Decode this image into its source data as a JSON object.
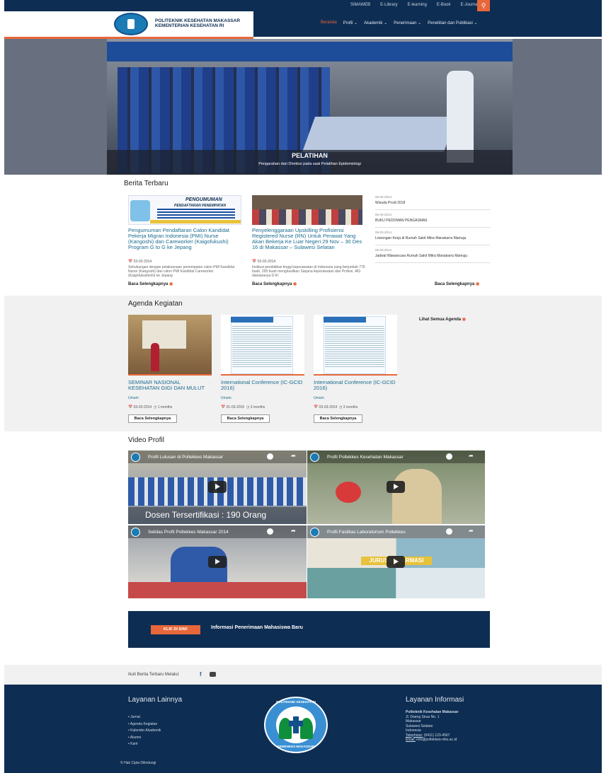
{
  "header": {
    "toplinks": [
      "SIMAWEB",
      "E-Library",
      "E-learning",
      "E-Book",
      "E-Journal"
    ],
    "search_icon": "search-icon",
    "logo_line1": "POLITEKNIK KESEHATAN MAKASSAR",
    "logo_line2": "KEMENTERIAN KESEHATAN RI",
    "nav": [
      "Beranda",
      "Profil ⌄",
      "Akademik ⌄",
      "Penerimaan ⌄",
      "Penelitian dan Publikasi ⌄"
    ],
    "accent_color": "#e8673a",
    "brand_color": "#0e2d52"
  },
  "hero": {
    "title": "PELATIHAN",
    "subtitle": "Pengarahan dari Direktur pada saat Pelatihan Epidemiologi"
  },
  "berita": {
    "section_title": "Berita Terbaru",
    "items": [
      {
        "thumb_heading": "PENGUMUMAN",
        "thumb_sub": "PENDAFTARAN PENEMPATAN",
        "title": "Pengumuman Pendaftaran Calon Kandidat Pekerja Migran Indonesia (PMI) Nurse (Kangoshi) dan Careworker (Kaigofukushi) Program G to G ke Jepang",
        "date": "03-03-2014",
        "excerpt": "Sehubungan dengan pelaksanaan penempatan calon PMI Kandidat Nurse (Kangoshi) dan calon PMI Kandidat Careworker (Kaigofukushishi) ke Jepang",
        "readmore": "Baca Selengkapnya"
      },
      {
        "title": "Penyelenggaraan Upskilling Profisiensi Registered Nurse (RN) Untuk Perawat Yang Akan Bekerja Ke Luar Negeri 29 Nov – 30 Des 16 di Makassar – Sulawesi Selatan",
        "date": "03-03-2014",
        "excerpt": "Institusi pendidikan tinggi keperawatan di Indonesia yang berjumlah 776 buah, 295 buah menghasilkan Sarjana keperawatan dan Profesi, 481 diantaranya D-III",
        "readmore": "Baca Selengkapnya"
      }
    ],
    "sidebar": [
      {
        "date": "05-03-2014",
        "title": "Wisuda Prodi 2018"
      },
      {
        "date": "05-03-2014",
        "title": "BUKU PEDOMAN PENGASMAS"
      },
      {
        "date": "05-03-2014",
        "title": "Lowongan Kerja di Rumah Sakit Mitra Manakarra Mamuju"
      },
      {
        "date": "05-03-2014",
        "title": "Jadwal Wawancara Rumah Sakit Mitra Manakarra Mamuju"
      }
    ],
    "sidebar_readmore": "Baca Selengkapnya"
  },
  "agenda": {
    "section_title": "Agenda Kegiatan",
    "see_all": "Lihat Semua Agenda",
    "items": [
      {
        "title": "SEMINAR NASIONAL KESEHATAN GIGI DAN MULUT",
        "category": "Umum",
        "date": "03-03-2014",
        "duration": "1 months",
        "button": "Baca Selengkapnya"
      },
      {
        "title": "International Conference (IC-GCID 2016)",
        "category": "Umum",
        "date": "01-03-2016",
        "duration": "3 months",
        "button": "Baca Selengkapnya"
      },
      {
        "title": "International Conference (IC-GCID 2016)",
        "category": "Umum",
        "date": "03-03-2014",
        "duration": "3 months",
        "button": "Baca Selengkapnya"
      }
    ]
  },
  "video": {
    "section_title": "Video Profil",
    "items": [
      {
        "title": "Profil Lulusan di Poltekkes Makassar",
        "overlay": "Dosen Tersertifikasi : 190 Orang",
        "watch_later": "Watch later",
        "share": "Share"
      },
      {
        "title": "Profil Poltekkes Kesehatan Makassar",
        "overlay": "",
        "watch_later": "Watch later",
        "share": "Share"
      },
      {
        "title": "Sekilas Profil Poltekkes Makassar 2014",
        "overlay": "",
        "watch_later": "Watch later",
        "share": "Share"
      },
      {
        "title": "Profil Fasilitas Laboratorium Poltekkes",
        "overlay": "JURUSAN FARMASI",
        "watch_later": "Watch later",
        "share": "Share"
      }
    ]
  },
  "cta": {
    "button": "KLIK DI SINI!",
    "text": "Informasi Penerimaan Mahasiswa Baru"
  },
  "social": {
    "label": "Ikuti Berita Terbaru Melalui:",
    "fb": "f"
  },
  "footer": {
    "left_title": "Layanan Lainnya",
    "links": [
      "Jurnal",
      "Agenda Kegiatan",
      "Kalender Akademik",
      "Alumni",
      "Karir"
    ],
    "seal_top": "POLITEKNIK KESEHATAN",
    "seal_bottom": "KEMENKES MAKASSAR",
    "right_title": "Layanan Informasi",
    "org": "Politeknik Kesehatan Makassar",
    "address": "Jl. Daeng Sirua No. 1",
    "city": "Makassar",
    "province": "Sulawesi Selatan",
    "country": "Indonesia",
    "phone_label": "Telephone:",
    "phone": "(0411) 123-4567",
    "email_label": "Email:",
    "email": "info@poltekkes-mks.ac.id",
    "copyright": "© Hak Cipta Dilindungi"
  }
}
